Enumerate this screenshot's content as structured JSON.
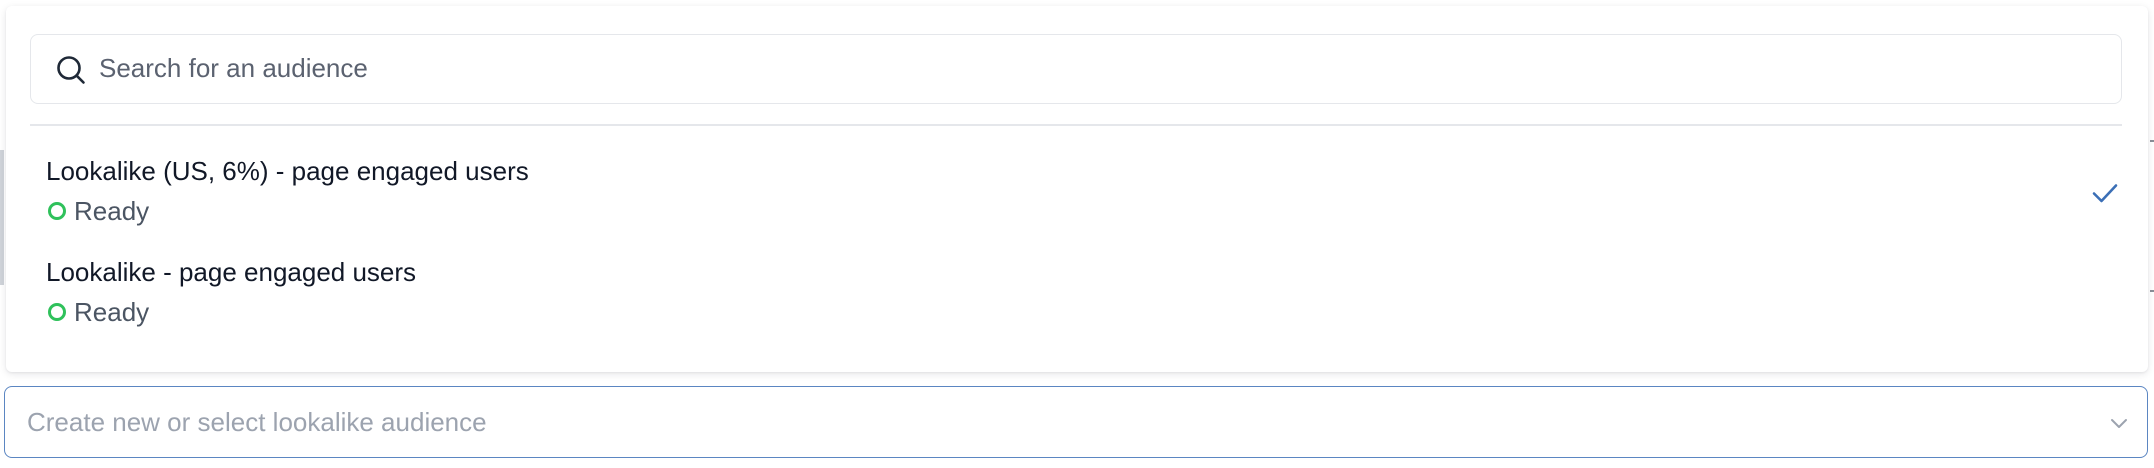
{
  "search": {
    "placeholder": "Search for an audience",
    "value": "",
    "icon": "search-icon"
  },
  "options": [
    {
      "title": "Lookalike (US, 6%) - page engaged users",
      "status": "Ready",
      "status_color": "#2fc15b",
      "selected": true
    },
    {
      "title": "Lookalike - page engaged users",
      "status": "Ready",
      "status_color": "#2fc15b",
      "selected": false
    }
  ],
  "select": {
    "placeholder": "Create new or select lookalike audience",
    "icon": "chevron-down-icon"
  },
  "colors": {
    "accent": "#3b6fb6",
    "status_ready": "#2fc15b",
    "border_focus": "#5b86c2"
  }
}
